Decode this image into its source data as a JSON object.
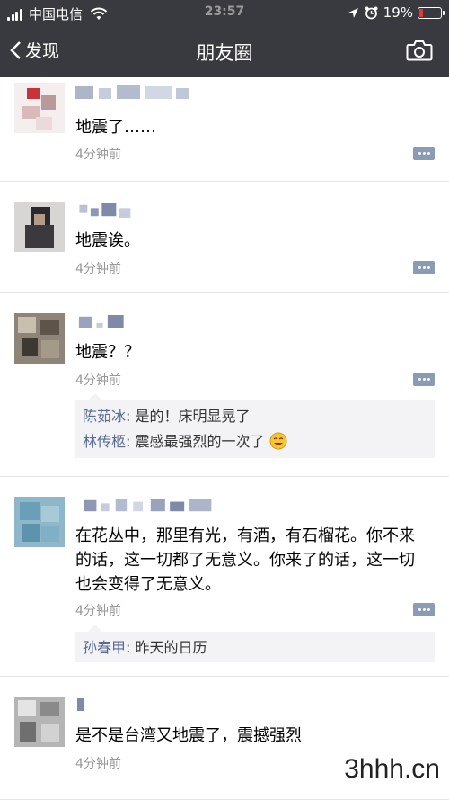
{
  "status_bar": {
    "carrier": "中国电信",
    "time": "23:57",
    "battery": "19%",
    "battery_level": 0.19
  },
  "nav": {
    "back_label": "发现",
    "title": "朋友圈"
  },
  "posts": [
    {
      "content": "地震了……",
      "time": "4分钟前",
      "comments": []
    },
    {
      "content": "地震诶。",
      "time": "4分钟前",
      "comments": []
    },
    {
      "content": "地震？？",
      "time": "4分钟前",
      "comments": [
        {
          "name": "陈茹冰",
          "sep": ": ",
          "text": "是的！床明显晃了"
        },
        {
          "name": "林传柩",
          "sep": ": ",
          "text": "震感最强烈的一次了"
        }
      ]
    },
    {
      "content": "在花丛中，那里有光，有酒，有石榴花。你不来的话，这一切都了无意义。你来了的话，这一切也会变得了无意义。",
      "time": "4分钟前",
      "comments": [
        {
          "name": "孙春甲",
          "sep": ": ",
          "text": "昨天的日历"
        }
      ]
    },
    {
      "content": "是不是台湾又地震了，震撼强烈",
      "time": "4分钟前",
      "comments": []
    }
  ],
  "watermark": "3hhh.cn",
  "colors": {
    "nav_bg": "#393a3f",
    "comment_name": "#576b95",
    "comment_bg": "#f3f3f5",
    "time_text": "#999999"
  }
}
